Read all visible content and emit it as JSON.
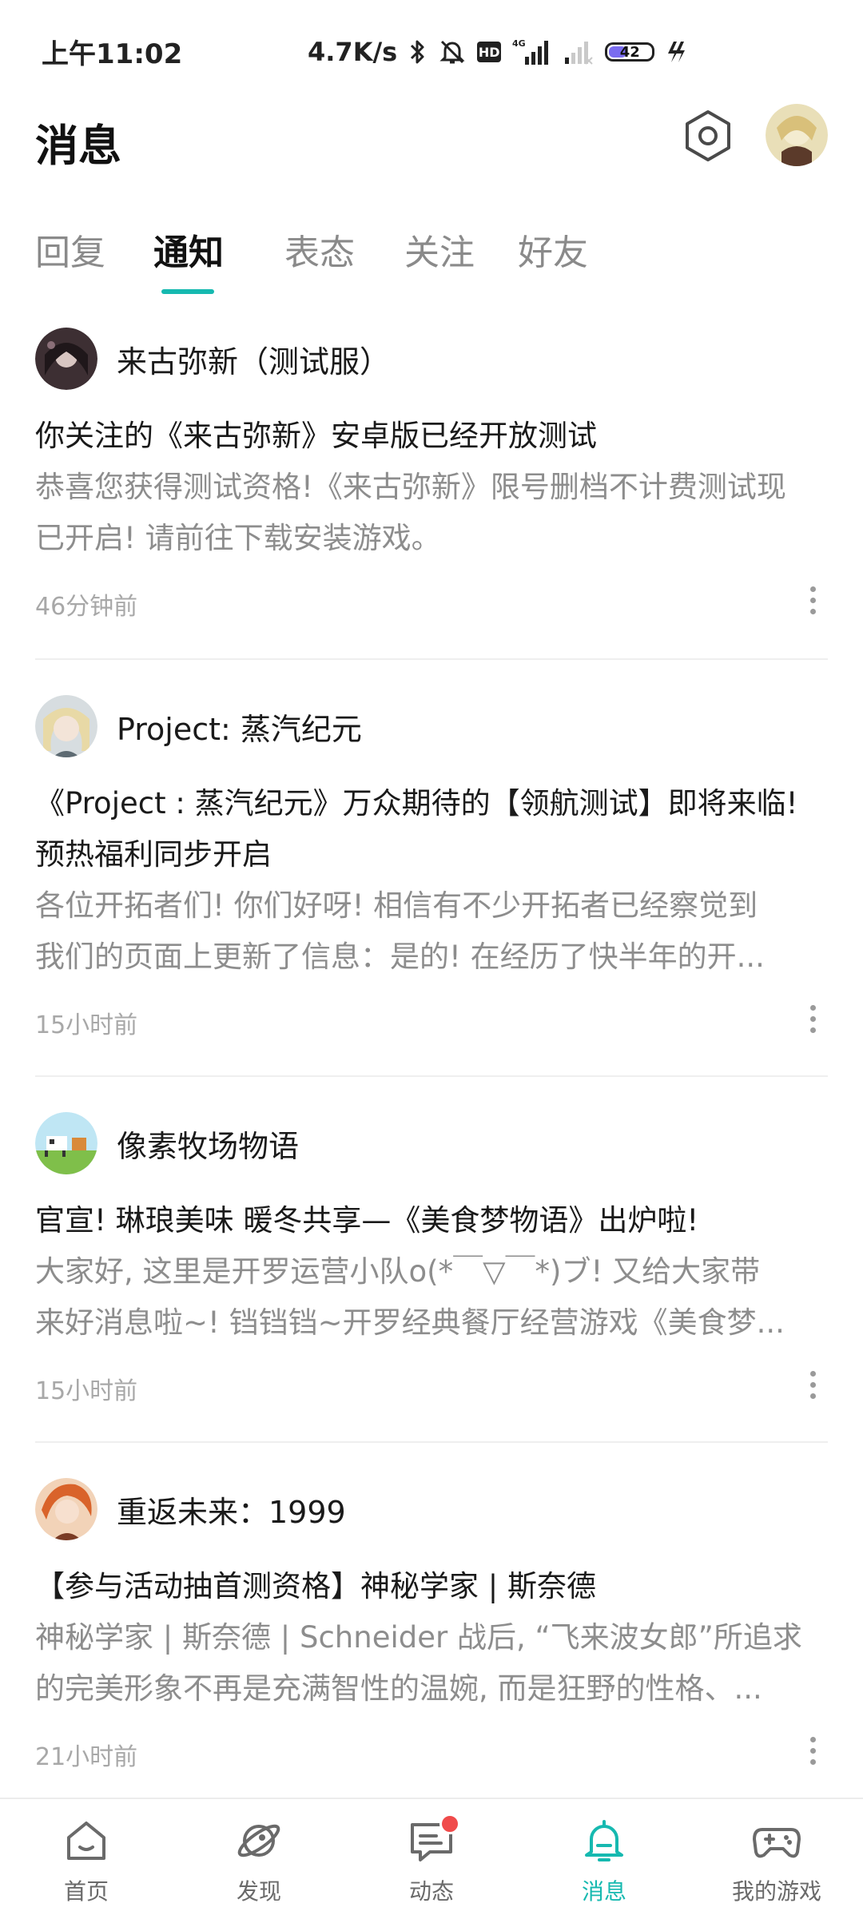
{
  "status_bar": {
    "time": "上午11:02",
    "net_speed": "4.7K/s",
    "hd_label": "HD",
    "network_label": "4G",
    "battery": "42",
    "battery_level": 0.42,
    "icons": [
      "bluetooth-icon",
      "mute-bell-icon",
      "hd-icon",
      "signal-4g-icon",
      "signal-weak-icon",
      "battery-icon",
      "charging-icon"
    ]
  },
  "header": {
    "title": "消息"
  },
  "tabs": [
    {
      "label": "回复",
      "active": false
    },
    {
      "label": "通知",
      "active": true
    },
    {
      "label": "表态",
      "active": false
    },
    {
      "label": "关注",
      "active": false
    },
    {
      "label": "好友",
      "active": false
    }
  ],
  "notifications": [
    {
      "source": "来古弥新（测试服）",
      "title_lines": [
        "你关注的《来古弥新》安卓版已经开放测试"
      ],
      "body_lines": [
        "恭喜您获得测试资格!《来古弥新》限号删档不计费测试现",
        "已开启! 请前往下载安装游戏。"
      ],
      "time": "46分钟前"
    },
    {
      "source": "Project: 蒸汽纪元",
      "title_lines": [
        "《Project : 蒸汽纪元》万众期待的【领航测试】即将来临!",
        "预热福利同步开启"
      ],
      "body_lines": [
        "各位开拓者们! 你们好呀!  相信有不少开拓者已经察觉到",
        "我们的页面上更新了信息：是的! 在经历了快半年的开..."
      ],
      "time": "15小时前"
    },
    {
      "source": "像素牧场物语",
      "title_lines": [
        "官宣! 琳琅美味 暖冬共享—《美食梦物语》出炉啦!"
      ],
      "body_lines": [
        "大家好, 这里是开罗运营小队o(*￣▽￣*)ブ! 又给大家带",
        "来好消息啦~!  铛铛铛~开罗经典餐厅经营游戏《美食梦..."
      ],
      "time": "15小时前"
    },
    {
      "source": "重返未来：1999",
      "title_lines": [
        "【参与活动抽首测资格】神秘学家 | 斯奈德"
      ],
      "body_lines": [
        "神秘学家 | 斯奈德 | Schneider 战后, “飞来波女郎”所追求",
        "的完美形象不再是充满智性的温婉, 而是狂野的性格、..."
      ],
      "time": "21小时前"
    }
  ],
  "bottom_nav": [
    {
      "label": "首页",
      "icon": "home-icon",
      "active": false
    },
    {
      "label": "发现",
      "icon": "discover-planet-icon",
      "active": false
    },
    {
      "label": "动态",
      "icon": "chat-icon",
      "active": false,
      "badge": true
    },
    {
      "label": "消息",
      "icon": "bell-icon",
      "active": true
    },
    {
      "label": "我的游戏",
      "icon": "gamepad-icon",
      "active": false
    }
  ],
  "colors": {
    "accent": "#16b9b0",
    "badge": "#f04b4b",
    "muted_text": "#8d8d8d"
  }
}
